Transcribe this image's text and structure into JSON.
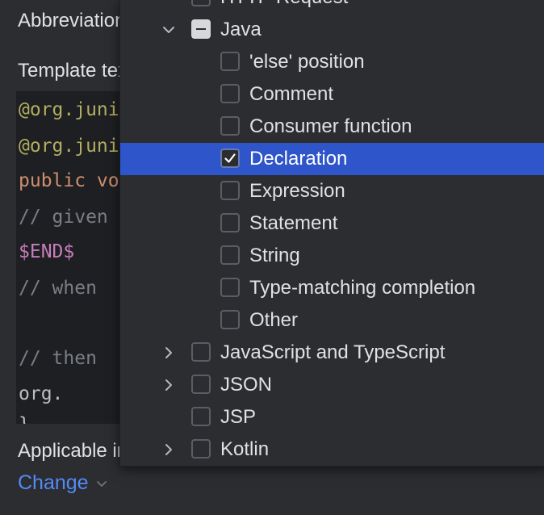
{
  "settings": {
    "abbreviation_label": "Abbreviation:",
    "template_text_label": "Template text:",
    "applicable_label": "Applicable in",
    "change_link": "Change"
  },
  "code": {
    "lines": [
      "@org.junit",
      "@org.junit",
      "public void",
      "    // given",
      "    $END$",
      "    // when",
      "",
      "    // then",
      "    org.",
      "}"
    ]
  },
  "popup": {
    "items": [
      {
        "label": "HTTP Request",
        "level": 0,
        "expandable": false,
        "expanded": false,
        "state": "unchecked"
      },
      {
        "label": "Java",
        "level": 0,
        "expandable": true,
        "expanded": true,
        "state": "indeterminate"
      },
      {
        "label": "'else' position",
        "level": 1,
        "expandable": false,
        "expanded": false,
        "state": "unchecked"
      },
      {
        "label": "Comment",
        "level": 1,
        "expandable": false,
        "expanded": false,
        "state": "unchecked"
      },
      {
        "label": "Consumer function",
        "level": 1,
        "expandable": false,
        "expanded": false,
        "state": "unchecked"
      },
      {
        "label": "Declaration",
        "level": 1,
        "expandable": false,
        "expanded": false,
        "state": "checked",
        "selected": true
      },
      {
        "label": "Expression",
        "level": 1,
        "expandable": false,
        "expanded": false,
        "state": "unchecked"
      },
      {
        "label": "Statement",
        "level": 1,
        "expandable": false,
        "expanded": false,
        "state": "unchecked"
      },
      {
        "label": "String",
        "level": 1,
        "expandable": false,
        "expanded": false,
        "state": "unchecked"
      },
      {
        "label": "Type-matching completion",
        "level": 1,
        "expandable": false,
        "expanded": false,
        "state": "unchecked"
      },
      {
        "label": "Other",
        "level": 1,
        "expandable": false,
        "expanded": false,
        "state": "unchecked"
      },
      {
        "label": "JavaScript and TypeScript",
        "level": 0,
        "expandable": true,
        "expanded": false,
        "state": "unchecked"
      },
      {
        "label": "JSON",
        "level": 0,
        "expandable": true,
        "expanded": false,
        "state": "unchecked"
      },
      {
        "label": "JSP",
        "level": 0,
        "expandable": false,
        "expanded": false,
        "state": "unchecked"
      },
      {
        "label": "Kotlin",
        "level": 0,
        "expandable": true,
        "expanded": false,
        "state": "unchecked"
      }
    ]
  },
  "colors": {
    "background": "#2b2d30",
    "selection": "#2e55c9",
    "link": "#548af7"
  }
}
